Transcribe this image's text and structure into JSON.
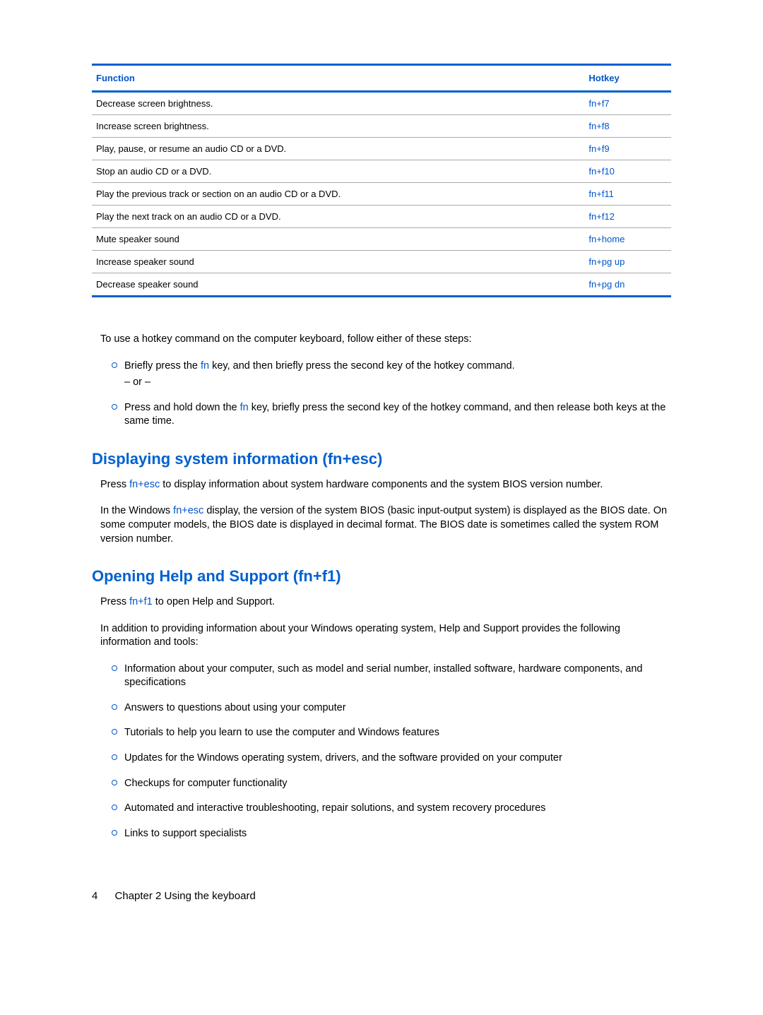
{
  "table": {
    "headers": {
      "function": "Function",
      "hotkey": "Hotkey"
    },
    "rows": [
      {
        "function": "Decrease screen brightness.",
        "hotkey": "fn+f7"
      },
      {
        "function": "Increase screen brightness.",
        "hotkey": "fn+f8"
      },
      {
        "function": "Play, pause, or resume an audio CD or a DVD.",
        "hotkey": "fn+f9"
      },
      {
        "function": "Stop an audio CD or a DVD.",
        "hotkey": "fn+f10"
      },
      {
        "function": "Play the previous track or section on an audio CD or a DVD.",
        "hotkey": "fn+f11"
      },
      {
        "function": "Play the next track on an audio CD or a DVD.",
        "hotkey": "fn+f12"
      },
      {
        "function": "Mute speaker sound",
        "hotkey": "fn+home"
      },
      {
        "function": "Increase speaker sound",
        "hotkey": "fn+pg up"
      },
      {
        "function": "Decrease speaker sound",
        "hotkey": "fn+pg dn"
      }
    ]
  },
  "intro": "To use a hotkey command on the computer keyboard, follow either of these steps:",
  "steps": {
    "step1_pre": "Briefly press the ",
    "step1_key": "fn",
    "step1_post": " key, and then briefly press the second key of the hotkey command.",
    "or": "– or –",
    "step2_pre": "Press and hold down the ",
    "step2_key": "fn",
    "step2_post": " key, briefly press the second key of the hotkey command, and then release both keys at the same time."
  },
  "section1": {
    "heading": "Displaying system information (fn+esc)",
    "p1_pre": "Press ",
    "p1_key": "fn+esc",
    "p1_post": " to display information about system hardware components and the system BIOS version number.",
    "p2_pre": "In the Windows ",
    "p2_key": "fn+esc",
    "p2_post": " display, the version of the system BIOS (basic input-output system) is displayed as the BIOS date. On some computer models, the BIOS date is displayed in decimal format. The BIOS date is sometimes called the system ROM version number."
  },
  "section2": {
    "heading": "Opening Help and Support (fn+f1)",
    "p1_pre": "Press ",
    "p1_key": "fn+f1",
    "p1_post": " to open Help and Support.",
    "p2": "In addition to providing information about your Windows operating system, Help and Support provides the following information and tools:",
    "items": [
      "Information about your computer, such as model and serial number, installed software, hardware components, and specifications",
      "Answers to questions about using your computer",
      "Tutorials to help you learn to use the computer and Windows features",
      "Updates for the Windows operating system, drivers, and the software provided on your computer",
      "Checkups for computer functionality",
      "Automated and interactive troubleshooting, repair solutions, and system recovery procedures",
      "Links to support specialists"
    ]
  },
  "footer": {
    "page": "4",
    "chapter": "Chapter 2   Using the keyboard"
  }
}
